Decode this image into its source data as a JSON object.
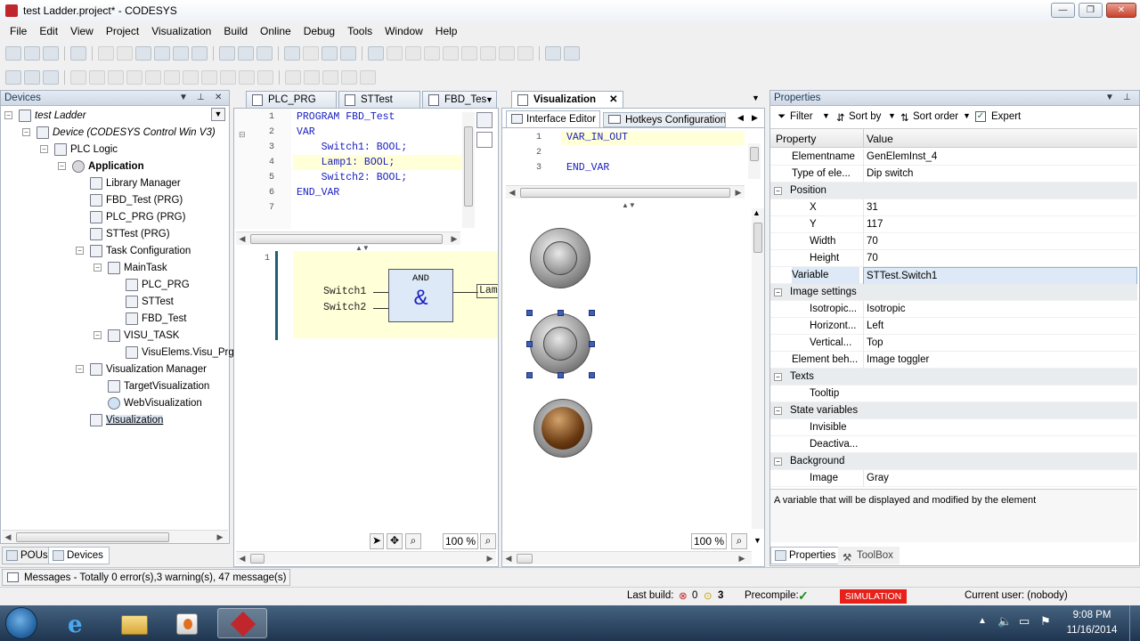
{
  "window": {
    "title": "test Ladder.project* - CODESYS",
    "min": "—",
    "max": "❐",
    "close": "✕"
  },
  "menu": [
    "File",
    "Edit",
    "View",
    "Project",
    "Visualization",
    "Build",
    "Online",
    "Debug",
    "Tools",
    "Window",
    "Help"
  ],
  "devices_panel": {
    "title": "Devices",
    "root": "test Ladder",
    "items": [
      {
        "label": "Device (CODESYS Control Win V3)",
        "italic": true
      },
      {
        "label": "PLC Logic"
      },
      {
        "label": "Application",
        "bold": true
      },
      {
        "label": "Library Manager"
      },
      {
        "label": "FBD_Test (PRG)"
      },
      {
        "label": "PLC_PRG (PRG)"
      },
      {
        "label": "STTest (PRG)"
      },
      {
        "label": "Task Configuration"
      },
      {
        "label": "MainTask"
      },
      {
        "label": "PLC_PRG"
      },
      {
        "label": "STTest"
      },
      {
        "label": "FBD_Test"
      },
      {
        "label": "VISU_TASK"
      },
      {
        "label": "VisuElems.Visu_Prg"
      },
      {
        "label": "Visualization Manager"
      },
      {
        "label": "TargetVisualization"
      },
      {
        "label": "WebVisualization"
      },
      {
        "label": "Visualization"
      }
    ]
  },
  "bottom_tabs": {
    "pous": "POUs",
    "devices": "Devices"
  },
  "editor_tabs": [
    "PLC_PRG",
    "STTest",
    "FBD_Tes",
    "Visualization"
  ],
  "fbd_editor": {
    "decl_lines": [
      "PROGRAM FBD_Test",
      "VAR",
      "    Switch1: BOOL;",
      "    Lamp1: BOOL;",
      "    Switch2: BOOL;",
      "END_VAR",
      ""
    ],
    "line_numbers": [
      "1",
      "2",
      "3",
      "4",
      "5",
      "6",
      "7"
    ],
    "network_number": "1",
    "block_type": "AND",
    "block_symbol": "&",
    "input1": "Switch1",
    "input2": "Switch2",
    "output": "Lam",
    "zoom": "100 %"
  },
  "visu_editor": {
    "subtabs": {
      "interface": "Interface Editor",
      "hotkeys": "Hotkeys Configuration"
    },
    "decl_lines": [
      "VAR_IN_OUT",
      "",
      "END_VAR"
    ],
    "line_numbers": [
      "1",
      "2",
      "3"
    ],
    "zoom": "100 %"
  },
  "properties": {
    "title": "Properties",
    "filter": "Filter",
    "sort_by": "Sort by",
    "sort_order": "Sort order",
    "expert": "Expert",
    "col_property": "Property",
    "col_value": "Value",
    "rows": [
      {
        "name": "Elementname",
        "value": "GenElemInst_4"
      },
      {
        "name": "Type of ele...",
        "value": "Dip switch"
      },
      {
        "name": "Position",
        "value": "",
        "group": true
      },
      {
        "name": "X",
        "value": "31",
        "indent": true
      },
      {
        "name": "Y",
        "value": "117",
        "indent": true
      },
      {
        "name": "Width",
        "value": "70",
        "indent": true
      },
      {
        "name": "Height",
        "value": "70",
        "indent": true
      },
      {
        "name": "Variable",
        "value": "STTest.Switch1",
        "selected": true
      },
      {
        "name": "Image settings",
        "value": "",
        "group": true
      },
      {
        "name": "Isotropic...",
        "value": "Isotropic",
        "indent": true
      },
      {
        "name": "Horizont...",
        "value": "Left",
        "indent": true
      },
      {
        "name": "Vertical...",
        "value": "Top",
        "indent": true
      },
      {
        "name": "Element beh...",
        "value": "Image toggler"
      },
      {
        "name": "Texts",
        "value": "",
        "group": true
      },
      {
        "name": "Tooltip",
        "value": "",
        "indent": true
      },
      {
        "name": "State variables",
        "value": "",
        "group": true
      },
      {
        "name": "Invisible",
        "value": "",
        "indent": true
      },
      {
        "name": "Deactiva...",
        "value": "",
        "indent": true
      },
      {
        "name": "Background",
        "value": "",
        "group": true
      },
      {
        "name": "Image",
        "value": "Gray",
        "indent": true
      }
    ],
    "description": "A variable that will be displayed and modified by the element",
    "tab_properties": "Properties",
    "tab_toolbox": "ToolBox"
  },
  "messages": "Messages - Totally 0 error(s),3 warning(s), 47 message(s)",
  "status": {
    "last_build": "Last build:",
    "errors": "0",
    "warnings": "3",
    "precompile": "Precompile:",
    "simulation": "SIMULATION",
    "current_user": "Current user: (nobody)"
  },
  "taskbar": {
    "time": "9:08 PM",
    "date": "11/16/2014"
  },
  "colors": {
    "accent": "#1a20c0",
    "simulation": "#e8201a",
    "decl_highlight": "#ffffd8"
  }
}
